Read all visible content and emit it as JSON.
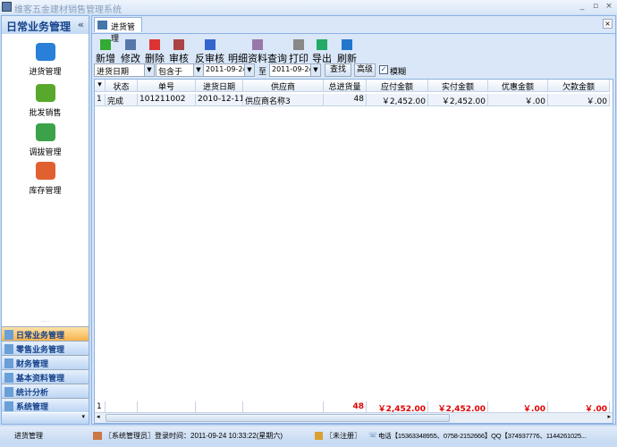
{
  "window": {
    "title": "维客五金建材销售管理系统"
  },
  "left": {
    "title": "日常业务管理",
    "collapse": "«",
    "nav": [
      {
        "label": "进货管理",
        "icon": "arrow-transfer-icon",
        "color": "#2a7fd8"
      },
      {
        "label": "批发销售",
        "icon": "boxes-icon",
        "color": "#58a82c"
      },
      {
        "label": "调拔管理",
        "icon": "swap-icon",
        "color": "#3ba24a"
      },
      {
        "label": "库存管理",
        "icon": "house-icon",
        "color": "#e06030"
      }
    ],
    "groups": [
      "日常业务管理",
      "零售业务管理",
      "财务管理",
      "基本资料管理",
      "统计分析",
      "系统管理"
    ]
  },
  "tab": {
    "label": "进货管理",
    "close": "×"
  },
  "toolbar": [
    "新增",
    "修改",
    "删除",
    "审核",
    "反审核",
    "明细资料查询",
    "打印",
    "导出",
    "刷新"
  ],
  "filter": {
    "field": "进货日期",
    "op": "包含于",
    "from": "2011-09-24",
    "to_label": "至",
    "to": "2011-09-24",
    "search": "查找",
    "advanced": "高级",
    "fuzzy_label": "模糊",
    "fuzzy": true
  },
  "grid": {
    "columns": [
      "状态",
      "单号",
      "进货日期",
      "供应商",
      "总进货量",
      "应付金额",
      "实付金额",
      "优惠金额",
      "欠款金额"
    ],
    "rows": [
      {
        "num": "1",
        "cells": [
          "完成",
          "101211002",
          "2010-12-11",
          "供应商名称3",
          "48",
          "￥2,452.00",
          "￥2,452.00",
          "￥.00",
          "￥.00"
        ]
      }
    ],
    "footer": {
      "count": "1",
      "cells": [
        "",
        "",
        "",
        "",
        "48",
        "￥2,452.00",
        "￥2,452.00",
        "￥.00",
        "￥.00"
      ]
    }
  },
  "status": {
    "module": "进货管理",
    "user": "〖系统管理员〗登录时间：2011-09-24  10:33:22(星期六)",
    "reg": "〖未注册〗",
    "contact": "电话【15363348955、0758-2152666】QQ【374937776、1144261025..."
  }
}
